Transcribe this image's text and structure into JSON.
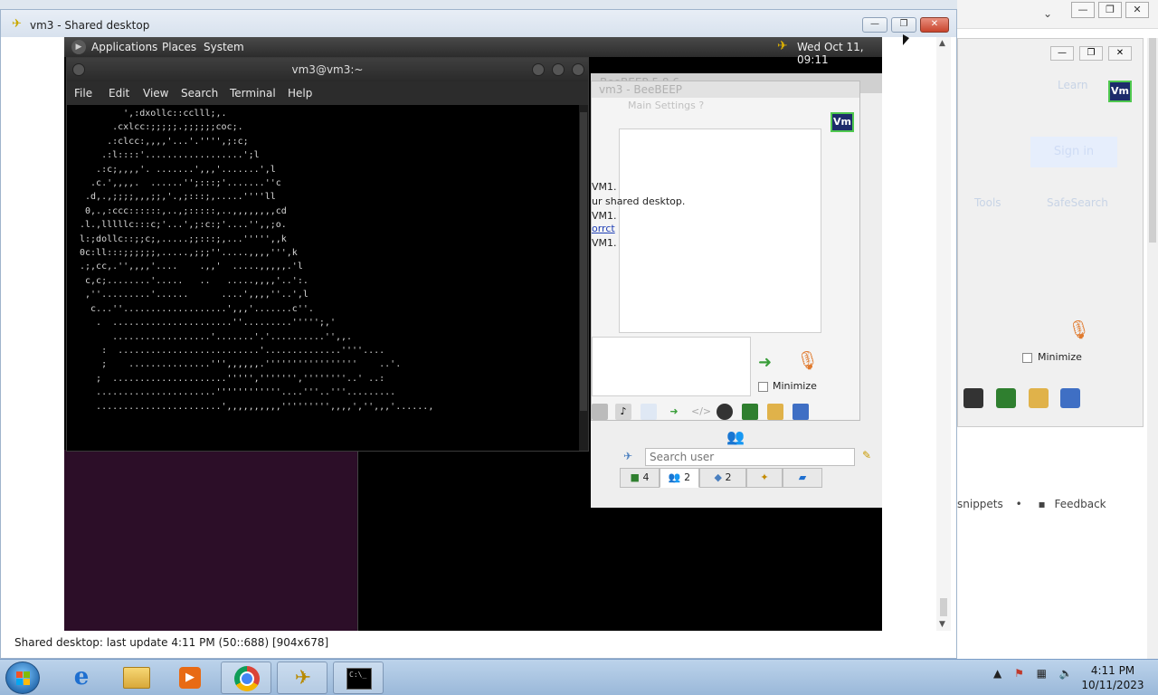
{
  "background_browser": {
    "controls": {
      "minimize": "—",
      "restore": "❐",
      "close": "✕"
    },
    "inner_controls": {
      "minimize": "—",
      "restore": "❐",
      "close": "✕"
    },
    "vm_badge": "Vm",
    "faded_text": {
      "learn": "Learn",
      "sign_in": "Sign in",
      "tools": "Tools",
      "safesearch": "SafeSearch"
    },
    "minimize_label": "Minimize",
    "links": {
      "snippets": "snippets",
      "bullet": "•",
      "feedback": "Feedback"
    }
  },
  "vnc_window": {
    "title": "vm3 - Shared desktop",
    "controls": {
      "minimize": "—",
      "maximize": "❐",
      "close": "✕"
    },
    "status_text": "Shared desktop: last update 4:11 PM (50::688) [904x678]"
  },
  "gnome_panel": {
    "menu": [
      "Applications",
      "Places",
      "System"
    ],
    "datetime": "Wed Oct 11, 09:11"
  },
  "terminal": {
    "title": "vm3@vm3:~",
    "menu": [
      "File",
      "Edit",
      "View",
      "Search",
      "Terminal",
      "Help"
    ],
    "lines": [
      "        ',:dxollc::cclll;,.",
      "      .cxlcc:;;;;;.;;;;;;coc;.",
      "     .:clcc:,,,,'...'.'''',;:c;",
      "    .:l::::'..................';l",
      "   .:c;,,,,'. .......',,,'.......',l",
      "  .c.',,,,.  ......'';:::;'.......''c",
      " .d,.,;;;;,,,;;,'.,;:::;,.....''''ll",
      " 0,.,:ccc::::::,..,;:::::,..,,,,,,,,cd",
      ".l.,lllllc:::c;'...',;:c:;'....'',,;o.",
      "l:;dollc::;;c;,.....;;:::;,...''''',,k",
      "0c:ll:::;;;;;;,.....,;;;''.....,,,,''',k",
      ".;,cc,.'',,,,'....    .,,'  .....,,,,,.'l",
      " c,c;........'.....   ..   .....,,,,'..':.",
      " ,''.........'......      ....',,,,''..',l",
      "  c...''...................',,,'.......c''.",
      "   .  ......................''.........''''';,'",
      "      ..................'.......'.'..........'',,.",
      "    :  ..........................'..............''''....",
      "    ;    ...............''',,,,,,.'''''''''''''''''    ..'.",
      "   ;  .....................''''',''''''',''''''''..' ..:",
      "   ......................''''''''''''....'''..'''.........",
      "   .......................',,,,,,,,,,''''''''',,,,','',,,'......,"
    ]
  },
  "beebeep": {
    "title": "BeeBEEP 5.8.6",
    "chat_title": "vm3 - BeeBEEP",
    "menu": "Main  Settings  ?",
    "vm_badge": "Vm",
    "messages": {
      "l1": "VM1.",
      "l2": "ur shared desktop.",
      "l3": "VM1.",
      "l4": "orrct",
      "l5": "VM1."
    },
    "minimize_label": "Minimize",
    "search_placeholder": "Search user",
    "tabs": [
      "4",
      "2",
      "2",
      ""
    ]
  },
  "taskbar": {
    "clock_time": "4:11 PM",
    "clock_date": "10/11/2023",
    "cmd_label": "C:\\_"
  },
  "colors": {
    "taskbar": "#9ab8d9",
    "terminal_bg": "#000000",
    "desktop_purple": "#2c0e28",
    "vm_badge_bg": "#1c2b6b",
    "vm_badge_border": "#4fc84f"
  }
}
